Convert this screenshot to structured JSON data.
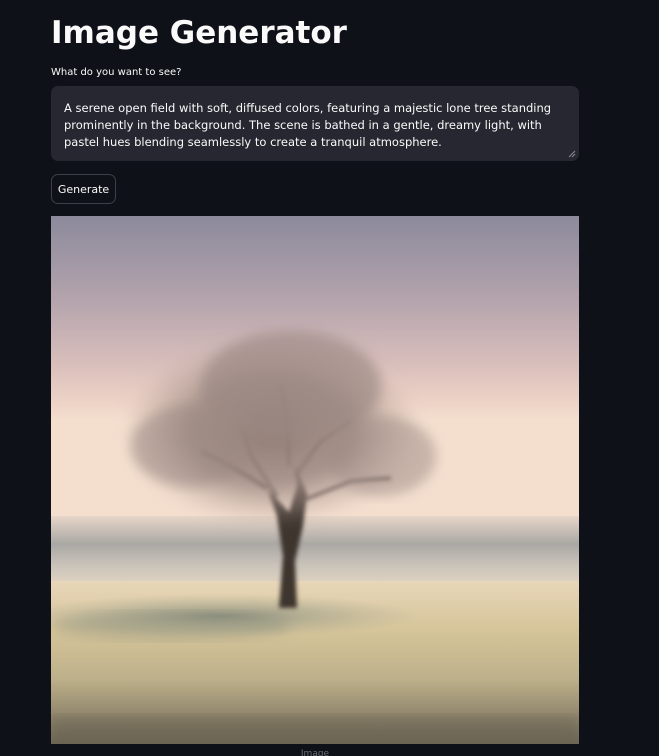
{
  "app": {
    "title": "Image Generator"
  },
  "prompt": {
    "label": "What do you want to see?",
    "value": "A serene open field with soft, diffused colors, featuring a majestic lone tree standing prominently in the background. The scene is bathed in a gentle, dreamy light, with pastel hues blending seamlessly to create a tranquil atmosphere."
  },
  "actions": {
    "generate_label": "Generate"
  },
  "result": {
    "caption": "Image",
    "image_icon": "generated-tree-image"
  },
  "colors": {
    "background": "#0e1117",
    "input_background": "#262730",
    "text": "#fafafa",
    "button_border": "#3d3f49"
  }
}
